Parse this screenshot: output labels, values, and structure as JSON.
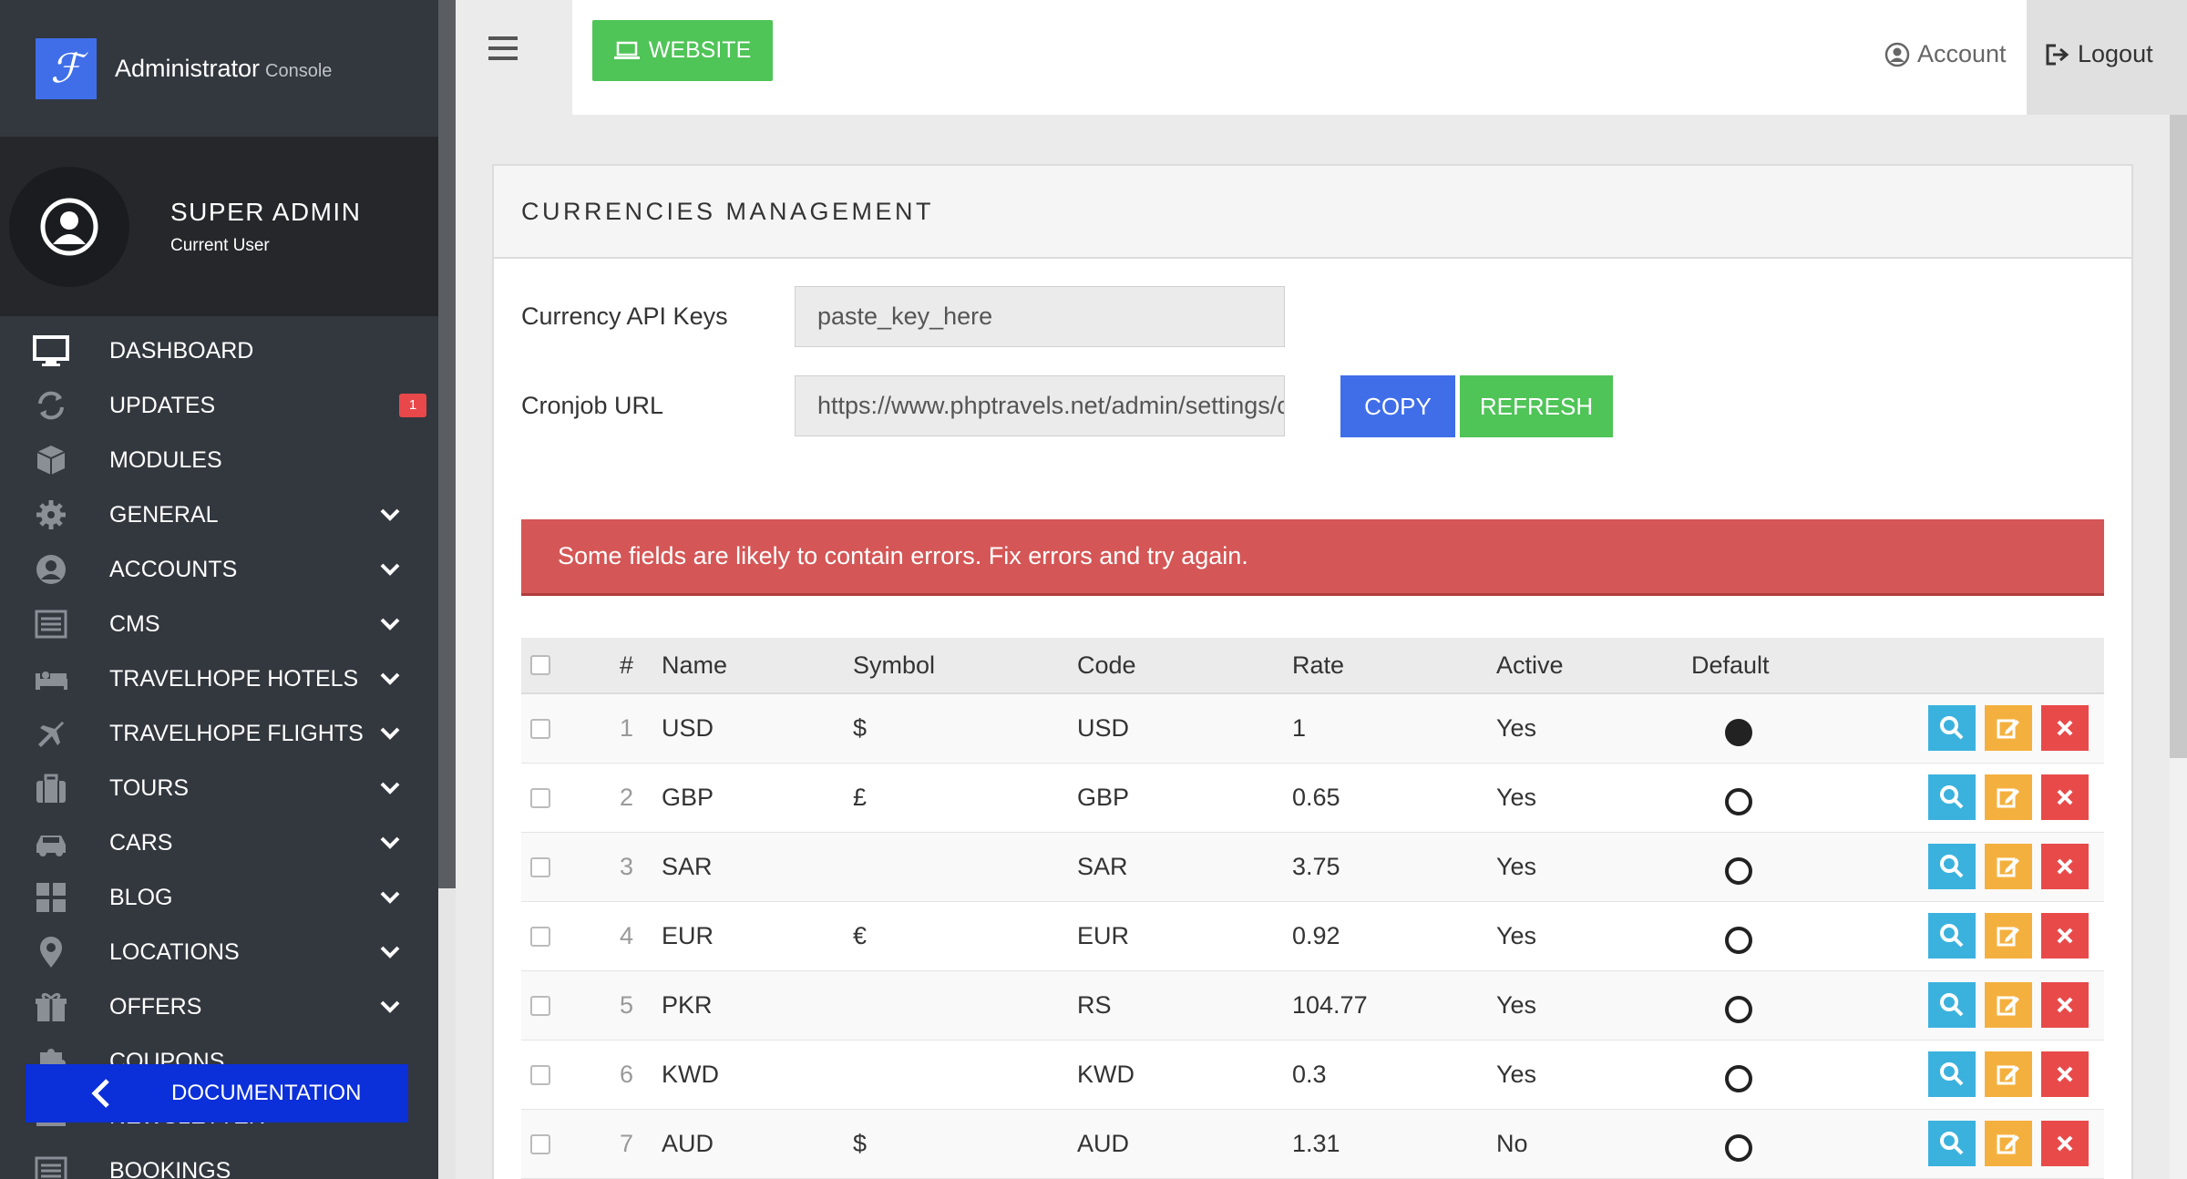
{
  "brand": {
    "title": "Administrator",
    "subtitle": "Console"
  },
  "user": {
    "name": "SUPER ADMIN",
    "role": "Current User"
  },
  "sidebar": {
    "items": [
      {
        "label": "DASHBOARD",
        "icon": "monitor-icon",
        "chevron": false
      },
      {
        "label": "UPDATES",
        "icon": "refresh-icon",
        "chevron": false,
        "badge": "1"
      },
      {
        "label": "MODULES",
        "icon": "cube-icon",
        "chevron": false
      },
      {
        "label": "GENERAL",
        "icon": "gear-icon",
        "chevron": true
      },
      {
        "label": "ACCOUNTS",
        "icon": "user-icon",
        "chevron": true
      },
      {
        "label": "CMS",
        "icon": "list-icon",
        "chevron": true
      },
      {
        "label": "TRAVELHOPE HOTELS",
        "icon": "bed-icon",
        "chevron": true
      },
      {
        "label": "TRAVELHOPE FLIGHTS",
        "icon": "plane-icon",
        "chevron": true
      },
      {
        "label": "TOURS",
        "icon": "suitcase-icon",
        "chevron": true
      },
      {
        "label": "CARS",
        "icon": "car-icon",
        "chevron": true
      },
      {
        "label": "BLOG",
        "icon": "grid-icon",
        "chevron": true
      },
      {
        "label": "LOCATIONS",
        "icon": "map-pin-icon",
        "chevron": true
      },
      {
        "label": "OFFERS",
        "icon": "gift-icon",
        "chevron": true
      },
      {
        "label": "COUPONS",
        "icon": "puzzle-icon",
        "chevron": false
      },
      {
        "label": "NEWSLETTER",
        "icon": "envelope-icon",
        "chevron": false
      },
      {
        "label": "BOOKINGS",
        "icon": "list-icon",
        "chevron": false
      }
    ],
    "documentation_label": "DOCUMENTATION"
  },
  "topbar": {
    "website_label": "WEBSITE",
    "account_label": "Account",
    "logout_label": "Logout"
  },
  "panel": {
    "title": "CURRENCIES MANAGEMENT",
    "api_keys_label": "Currency API Keys",
    "api_keys_value": "paste_key_here",
    "cronjob_label": "Cronjob URL",
    "cronjob_value": "https://www.phptravels.net/admin/settings/currencies/cronjob",
    "copy_label": "COPY",
    "refresh_label": "REFRESH",
    "alert": "Some fields are likely to contain errors. Fix errors and try again."
  },
  "table": {
    "headers": {
      "num": "#",
      "name": "Name",
      "symbol": "Symbol",
      "code": "Code",
      "rate": "Rate",
      "active": "Active",
      "default": "Default"
    },
    "rows": [
      {
        "num": "1",
        "name": "USD",
        "symbol": "$",
        "code": "USD",
        "rate": "1",
        "active": "Yes",
        "default": true
      },
      {
        "num": "2",
        "name": "GBP",
        "symbol": "£",
        "code": "GBP",
        "rate": "0.65",
        "active": "Yes",
        "default": false
      },
      {
        "num": "3",
        "name": "SAR",
        "symbol": "",
        "code": "SAR",
        "rate": "3.75",
        "active": "Yes",
        "default": false
      },
      {
        "num": "4",
        "name": "EUR",
        "symbol": "€",
        "code": "EUR",
        "rate": "0.92",
        "active": "Yes",
        "default": false
      },
      {
        "num": "5",
        "name": "PKR",
        "symbol": "",
        "code": "RS",
        "rate": "104.77",
        "active": "Yes",
        "default": false
      },
      {
        "num": "6",
        "name": "KWD",
        "symbol": "",
        "code": "KWD",
        "rate": "0.3",
        "active": "Yes",
        "default": false
      },
      {
        "num": "7",
        "name": "AUD",
        "symbol": "$",
        "code": "AUD",
        "rate": "1.31",
        "active": "No",
        "default": false
      }
    ]
  }
}
